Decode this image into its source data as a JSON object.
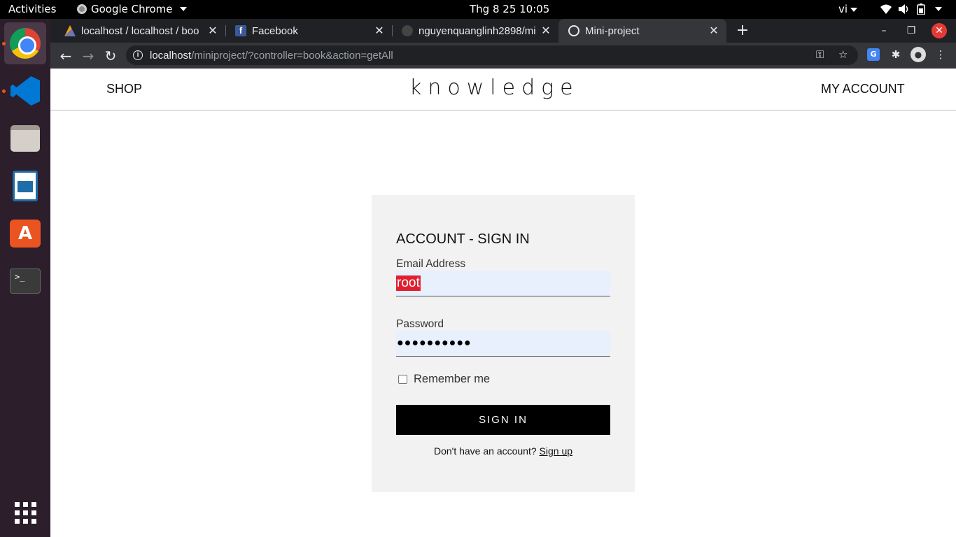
{
  "topbar": {
    "activities": "Activities",
    "app_name": "Google Chrome",
    "clock": "Thg 8 25  10:05",
    "lang": "vi",
    "tray_icons": [
      "wifi-icon",
      "volume-icon",
      "battery-icon"
    ]
  },
  "dock": {
    "items": [
      "chrome",
      "vscode",
      "files",
      "libreoffice-writer",
      "software-store",
      "terminal",
      "show-applications"
    ],
    "terminal_glyph": ">_"
  },
  "browser": {
    "tabs": [
      {
        "title": "localhost / localhost / boo",
        "favicon": "phpmyadmin-icon",
        "active": false
      },
      {
        "title": "Facebook",
        "favicon": "facebook-icon",
        "active": false
      },
      {
        "title": "nguyenquanglinh2898/mi",
        "favicon": "github-icon",
        "active": false
      },
      {
        "title": "Mini-project",
        "favicon": "globe-icon",
        "active": true
      }
    ],
    "url_host": "localhost",
    "url_path": "/miniproject/?controller=book&action=getAll",
    "accent": "#35363a"
  },
  "site": {
    "nav_left": "SHOP",
    "brand": "knowledge",
    "nav_right": "MY ACCOUNT"
  },
  "signin": {
    "title": "ACCOUNT - SIGN IN",
    "email_label": "Email Address",
    "email_value": "root",
    "password_label": "Password",
    "password_value": "●●●●●●●●●●",
    "remember_label": "Remember me",
    "remember_checked": false,
    "submit_label": "SIGN IN",
    "signup_prompt": "Don't have an account?",
    "signup_link": "Sign up",
    "button_color": "#000000",
    "input_bg": "#e8f0fe"
  }
}
